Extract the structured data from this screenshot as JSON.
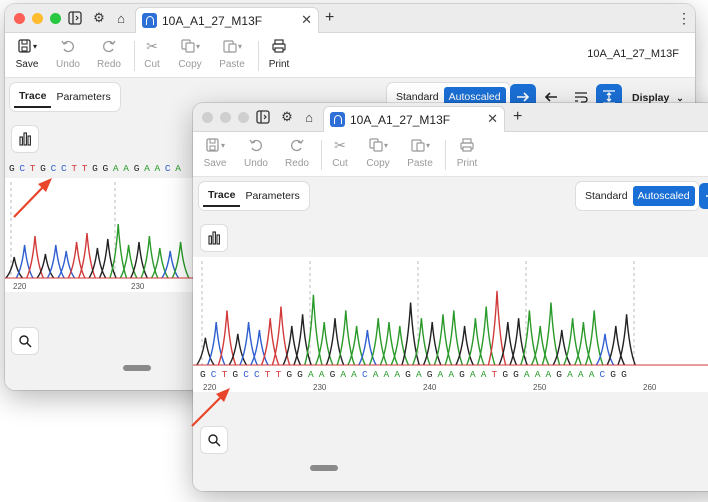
{
  "back": {
    "tab_title": "10A_A1_27_M13F",
    "filename": "10A_A1_27_M13F",
    "toolbar": {
      "save": "Save",
      "undo": "Undo",
      "redo": "Redo",
      "cut": "Cut",
      "copy": "Copy",
      "paste": "Paste",
      "print": "Print"
    },
    "view_tabs": [
      "Trace",
      "Parameters"
    ],
    "scale_options": [
      "Standard",
      "Autoscaled"
    ],
    "scale_selected": "Autoscaled",
    "display_label": "Display",
    "sequence": [
      "G",
      "C",
      "T",
      "G",
      "C",
      "C",
      "T",
      "T",
      "G",
      "G",
      "A",
      "A",
      "G",
      "A",
      "A",
      "C",
      "A"
    ],
    "ticks": [
      "220",
      "230"
    ]
  },
  "front": {
    "tab_title": "10A_A1_27_M13F",
    "toolbar": {
      "save": "Save",
      "undo": "Undo",
      "redo": "Redo",
      "cut": "Cut",
      "copy": "Copy",
      "paste": "Paste",
      "print": "Print"
    },
    "view_tabs": [
      "Trace",
      "Parameters"
    ],
    "scale_options": [
      "Standard",
      "Autoscaled"
    ],
    "scale_selected": "Autoscaled",
    "sequence": [
      "G",
      "C",
      "T",
      "G",
      "C",
      "C",
      "T",
      "T",
      "G",
      "G",
      "A",
      "A",
      "G",
      "A",
      "A",
      "C",
      "A",
      "A",
      "A",
      "G",
      "A",
      "G",
      "A",
      "A",
      "G",
      "A",
      "A",
      "T",
      "G",
      "G",
      "A",
      "A",
      "A",
      "G",
      "A",
      "A",
      "A",
      "C",
      "G",
      "G"
    ],
    "ticks": [
      "220",
      "230",
      "240",
      "250",
      "260"
    ]
  },
  "colors": {
    "A": "#2a9a2a",
    "C": "#2f5fd0",
    "G": "#222222",
    "T": "#d23a3a",
    "accent": "#1a6fd6",
    "arrow": "#e8452a"
  },
  "icons": [
    "sidebar-toggle-icon",
    "gear-icon",
    "home-icon",
    "close-icon",
    "plus-icon",
    "kebab-menu-icon",
    "save-icon",
    "undo-icon",
    "redo-icon",
    "scissors-icon",
    "copy-icon",
    "paste-icon",
    "printer-icon",
    "bar-chart-icon",
    "search-icon",
    "arrow-right-icon",
    "arrow-left-icon",
    "wrap-icon",
    "fit-icon",
    "chevron-down-icon"
  ]
}
